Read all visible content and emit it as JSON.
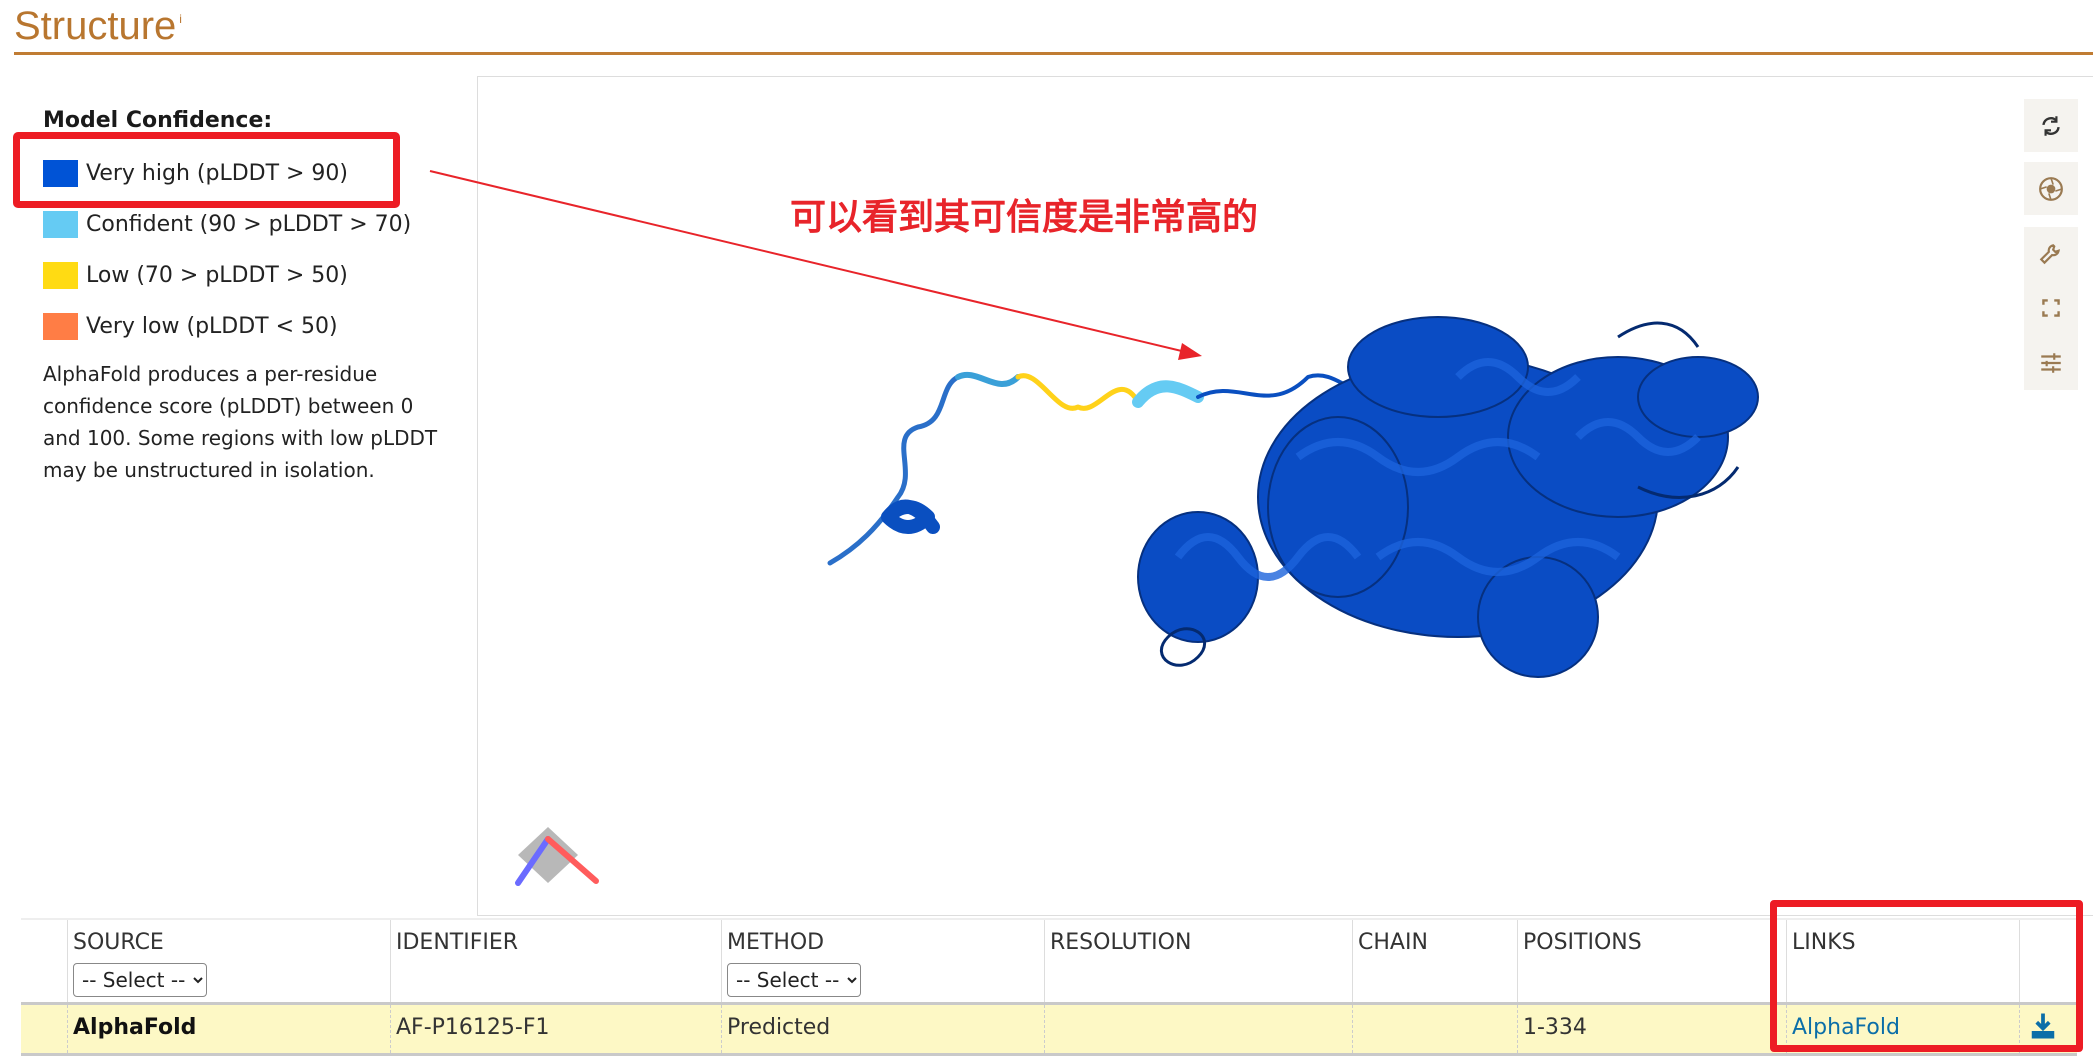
{
  "section": {
    "title": "Structure",
    "info": "i"
  },
  "legend": {
    "title": "Model Confidence:",
    "items": [
      {
        "label": "Very high (pLDDT > 90)",
        "color": "#0053d6"
      },
      {
        "label": "Confident (90 > pLDDT > 70)",
        "color": "#65cbf3"
      },
      {
        "label": "Low (70 > pLDDT > 50)",
        "color": "#ffdb13"
      },
      {
        "label": "Very low (pLDDT < 50)",
        "color": "#ff7d45"
      }
    ],
    "description": "AlphaFold produces a per-residue confidence score (pLDDT) between 0 and 100. Some regions with low pLDDT may be unstructured in isolation."
  },
  "annotation": {
    "text": "可以看到其可信度是非常高的",
    "color": "#e8242a"
  },
  "toolbar": [
    "reset-icon",
    "screenshot-icon",
    "settings-icon",
    "fullscreen-icon",
    "controls-icon"
  ],
  "table": {
    "headers": [
      "",
      "SOURCE",
      "IDENTIFIER",
      "METHOD",
      "RESOLUTION",
      "CHAIN",
      "POSITIONS",
      "LINKS",
      ""
    ],
    "source_filter": "-- Select --",
    "method_filter": "-- Select --",
    "rows": [
      {
        "source": "AlphaFold",
        "identifier": "AF-P16125-F1",
        "method": "Predicted",
        "resolution": "",
        "chain": "",
        "positions": "1-334",
        "link": "AlphaFold"
      }
    ]
  }
}
